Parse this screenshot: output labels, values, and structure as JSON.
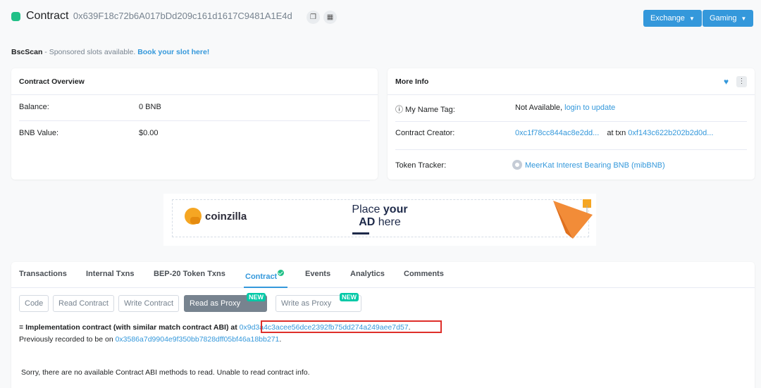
{
  "header": {
    "title": "Contract",
    "address": "0x639F18c72b6A017bDd209c161d1617C9481A1E4d",
    "buttons": [
      {
        "label": "Exchange"
      },
      {
        "label": "Gaming"
      }
    ]
  },
  "sponsor": {
    "brand": "BscScan",
    "text": " - Sponsored slots available. ",
    "cta": "Book your slot here!"
  },
  "overview": {
    "title": "Contract Overview",
    "balance_label": "Balance:",
    "balance_value": "0 BNB",
    "bnb_value_label": "BNB Value:",
    "bnb_value": "$0.00"
  },
  "more_info": {
    "title": "More Info",
    "name_tag_label": "ⓘ My Name Tag:",
    "name_tag_value": "Not Available, ",
    "name_tag_link": "login to update",
    "creator_label": "Contract Creator:",
    "creator_address": "0xc1f78cc844ac8e2dd...",
    "creator_at": " at txn ",
    "creator_txn": "0xf143c622b202b2d0d...",
    "token_label": "Token Tracker:",
    "token_value": "MeerKat Interest Bearing BNB (mibBNB)"
  },
  "ad": {
    "brand": "coinzilla",
    "line1_plain": "Place ",
    "line1_bold": "your",
    "line2_bold": "AD",
    "line2_plain": " here"
  },
  "tabs": [
    {
      "label": "Transactions"
    },
    {
      "label": "Internal Txns"
    },
    {
      "label": "BEP-20 Token Txns"
    },
    {
      "label": "Contract"
    },
    {
      "label": "Events"
    },
    {
      "label": "Analytics"
    },
    {
      "label": "Comments"
    }
  ],
  "subtabs": {
    "code": "Code",
    "read": "Read Contract",
    "write": "Write Contract",
    "read_proxy": "Read as Proxy",
    "write_proxy": "Write as Proxy",
    "new_badge": "NEW"
  },
  "implementation": {
    "label": "Implementation contract (with similar match contract ABI) at ",
    "address": "0x9d3a4c3acee56dce2392fb75dd274a249aee7d57",
    "end": "."
  },
  "previous": {
    "text": "Previously recorded to be on ",
    "address": "0x3586a7d9904e9f350bb7828dff05bf46a18bb271",
    "end": "."
  },
  "message": "Sorry, there are no available Contract ABI methods to read. Unable to read contract info.",
  "colors": {
    "accent": "#3498db",
    "success": "#21c087",
    "highlight": "#de2f2a"
  }
}
